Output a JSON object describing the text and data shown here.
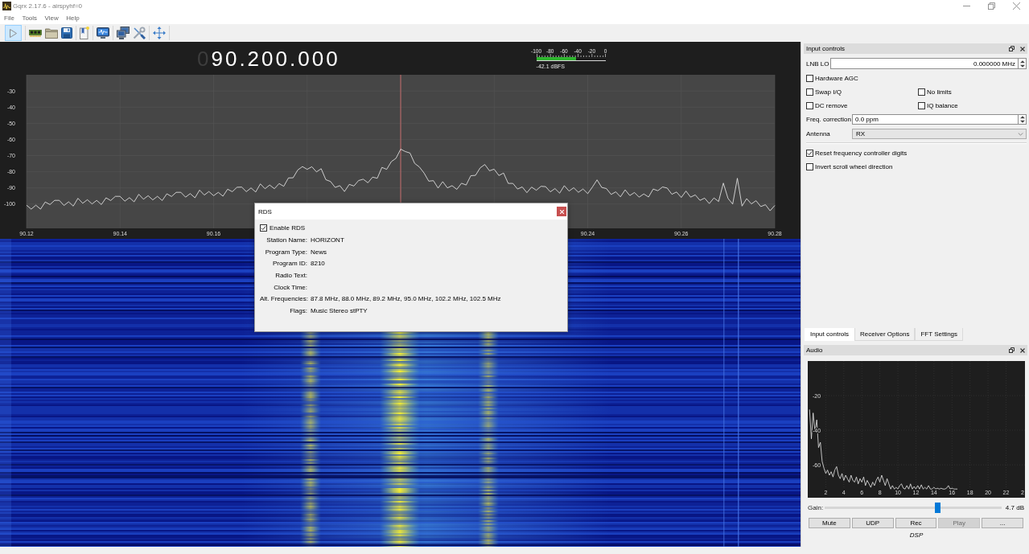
{
  "window": {
    "title": "Gqrx 2.17.6 - airspyhf=0"
  },
  "menu": [
    "File",
    "Tools",
    "View",
    "Help"
  ],
  "toolbar": {
    "start_button": {
      "on": true
    }
  },
  "receiver": {
    "frequency_leading": "0",
    "frequency": "90.200.000"
  },
  "signal_meter": {
    "scale": [
      "-100",
      "-80",
      "-60",
      "-40",
      "-20",
      "0"
    ],
    "level": 0.58,
    "reading": "-42.1 dBFS"
  },
  "spectrum": {
    "chart_data": {
      "type": "line",
      "xlim": [
        90.12,
        90.28
      ],
      "ylim": [
        -115,
        -20
      ],
      "xticks": [
        90.12,
        90.14,
        90.16,
        90.24,
        90.26,
        90.28
      ],
      "yticks": [
        -30,
        -40,
        -50,
        -60,
        -70,
        -80,
        -90,
        -100
      ],
      "grid": true,
      "color": "#f0f0f0",
      "ref_lines": [
        {
          "axis": "x",
          "value": 90.2,
          "color": "#c46a6a"
        }
      ],
      "x": [
        90.12,
        90.121,
        90.122,
        90.123,
        90.124,
        90.125,
        90.126,
        90.127,
        90.128,
        90.129,
        90.13,
        90.131,
        90.132,
        90.133,
        90.134,
        90.135,
        90.136,
        90.137,
        90.138,
        90.139,
        90.14,
        90.141,
        90.142,
        90.143,
        90.144,
        90.145,
        90.146,
        90.147,
        90.148,
        90.149,
        90.15,
        90.151,
        90.152,
        90.153,
        90.154,
        90.155,
        90.156,
        90.157,
        90.158,
        90.159,
        90.16,
        90.161,
        90.162,
        90.163,
        90.164,
        90.165,
        90.166,
        90.167,
        90.168,
        90.169,
        90.17,
        90.171,
        90.172,
        90.173,
        90.174,
        90.175,
        90.176,
        90.177,
        90.178,
        90.179,
        90.18,
        90.181,
        90.182,
        90.183,
        90.184,
        90.185,
        90.186,
        90.187,
        90.188,
        90.189,
        90.19,
        90.191,
        90.192,
        90.193,
        90.194,
        90.195,
        90.196,
        90.197,
        90.198,
        90.199,
        90.2,
        90.201,
        90.202,
        90.203,
        90.204,
        90.205,
        90.206,
        90.207,
        90.208,
        90.209,
        90.21,
        90.211,
        90.212,
        90.213,
        90.214,
        90.215,
        90.216,
        90.217,
        90.218,
        90.219,
        90.22,
        90.221,
        90.222,
        90.223,
        90.224,
        90.225,
        90.226,
        90.227,
        90.228,
        90.229,
        90.23,
        90.231,
        90.232,
        90.233,
        90.234,
        90.235,
        90.236,
        90.237,
        90.238,
        90.239,
        90.24,
        90.241,
        90.242,
        90.243,
        90.244,
        90.245,
        90.246,
        90.247,
        90.248,
        90.249,
        90.25,
        90.251,
        90.252,
        90.253,
        90.254,
        90.255,
        90.256,
        90.257,
        90.258,
        90.259,
        90.26,
        90.261,
        90.262,
        90.263,
        90.264,
        90.265,
        90.266,
        90.267,
        90.268,
        90.269,
        90.27,
        90.271,
        90.272,
        90.273,
        90.274,
        90.275,
        90.276,
        90.277,
        90.278,
        90.279,
        90.28
      ],
      "values": [
        -100.7,
        -103.1,
        -100.7,
        -103.1,
        -98.7,
        -100.3,
        -97.7,
        -97.7,
        -100.8,
        -98.6,
        -101.2,
        -96.4,
        -99.5,
        -97.3,
        -99.9,
        -97.7,
        -100.3,
        -96.1,
        -97.8,
        -95.2,
        -95.2,
        -98.2,
        -96.0,
        -98.6,
        -93.9,
        -97.0,
        -94.8,
        -97.4,
        -95.2,
        -97.8,
        -93.6,
        -95.3,
        -92.7,
        -92.7,
        -95.7,
        -93.5,
        -96.1,
        -91.3,
        -94.4,
        -92.2,
        -94.8,
        -92.7,
        -95.1,
        -90.8,
        -92.3,
        -89.6,
        -89.5,
        -92.3,
        -90.0,
        -92.5,
        -87.5,
        -90.5,
        -88.2,
        -90.5,
        -87.3,
        -89.0,
        -83.8,
        -83.7,
        -78.9,
        -76.8,
        -78.5,
        -76.9,
        -80.1,
        -78.1,
        -84.9,
        -86.0,
        -89.7,
        -88.6,
        -92.2,
        -87.8,
        -88.8,
        -85.4,
        -84.6,
        -86.8,
        -83.3,
        -84.0,
        -77.3,
        -78.5,
        -73.7,
        -71.7,
        -66.0,
        -67.5,
        -68.4,
        -74.8,
        -77.0,
        -80.8,
        -85.8,
        -85.5,
        -90.1,
        -86.1,
        -90.0,
        -88.6,
        -90.9,
        -87.1,
        -88.2,
        -82.4,
        -82.2,
        -77.6,
        -75.5,
        -79.4,
        -78.4,
        -82.3,
        -80.8,
        -87.2,
        -87.2,
        -90.7,
        -89.4,
        -92.9,
        -89.5,
        -91.4,
        -89.0,
        -89.2,
        -92.4,
        -90.4,
        -93.2,
        -88.6,
        -91.9,
        -89.9,
        -92.7,
        -90.7,
        -93.5,
        -89.5,
        -85.0,
        -89.7,
        -90.4,
        -94.0,
        -92.4,
        -95.5,
        -91.2,
        -94.7,
        -92.8,
        -95.7,
        -93.7,
        -95.6,
        -90.7,
        -91.7,
        -89.4,
        -90.1,
        -93.9,
        -92.5,
        -95.9,
        -91.9,
        -95.7,
        -94.3,
        -97.7,
        -96.3,
        -99.7,
        -96.2,
        -98.4,
        -87.0,
        -96.5,
        -100.0,
        -84.0,
        -101.2,
        -96.6,
        -99.9,
        -97.9,
        -101.5,
        -100.4,
        -104.1,
        -100.8
      ]
    }
  },
  "rds_dialog": {
    "title": "RDS",
    "enable": {
      "label": "Enable RDS",
      "checked": true
    },
    "fields": [
      {
        "label": "Station Name:",
        "value": "HORIZONT"
      },
      {
        "label": "Program Type:",
        "value": "News"
      },
      {
        "label": "Program ID:",
        "value": "8210"
      },
      {
        "label": "Radio Text:"
      },
      {
        "label": "Clock Time:"
      },
      {
        "label": "Alt. Frequencies:",
        "value": "87.8 MHz, 88.0 MHz, 89.2 MHz, 95.0 MHz, 102.2 MHz, 102.5 MHz"
      },
      {
        "label": "Flags:",
        "value": "Music Stereo stPTY"
      }
    ]
  },
  "input_controls": {
    "title": "Input controls",
    "lnb_lo": {
      "label": "LNB LO",
      "value": "0.000000 MHz"
    },
    "options": [
      [
        {
          "label": "Hardware AGC",
          "checked": false
        }
      ],
      [
        {
          "label": "Swap I/Q",
          "checked": false
        },
        {
          "label": "No limits",
          "checked": false
        }
      ],
      [
        {
          "label": "DC remove",
          "checked": false
        },
        {
          "label": "IQ balance",
          "checked": false
        }
      ]
    ],
    "freq_correction": {
      "label": "Freq. correction",
      "value": "0.0 ppm"
    },
    "antenna": {
      "label": "Antenna",
      "value": "RX"
    },
    "settings": [
      {
        "label": "Reset frequency controller digits",
        "checked": true
      },
      {
        "label": "Invert scroll wheel direction",
        "checked": false
      }
    ]
  },
  "dock_tabs": [
    {
      "label": "Input controls",
      "selected": true
    },
    {
      "label": "Receiver Options",
      "selected": false
    },
    {
      "label": "FFT Settings",
      "selected": false
    }
  ],
  "audio": {
    "title": "Audio",
    "chart_data": {
      "type": "line",
      "xlim": [
        0,
        24.1
      ],
      "ylim": [
        -79,
        0
      ],
      "xticks": [
        2,
        4,
        6,
        8,
        10,
        12,
        14,
        16,
        18,
        20,
        22
      ],
      "yticks": [
        -20,
        -40,
        -60
      ],
      "grid": true,
      "color": "#eaeaea",
      "x": [
        0.2,
        0.4,
        0.6,
        0.8,
        1,
        1.2,
        1.4,
        1.6,
        1.8,
        2,
        2.2,
        2.4,
        2.6,
        2.8,
        3,
        3.2,
        3.4,
        3.6,
        3.8,
        4,
        4.2,
        4.4,
        4.6,
        4.8,
        5,
        5.2,
        5.4,
        5.6,
        5.8,
        6,
        6.2,
        6.4,
        6.6,
        6.8,
        7,
        7.2,
        7.4,
        7.6,
        7.8,
        8,
        8.2,
        8.4,
        8.6,
        8.8,
        9,
        9.2,
        9.4,
        9.6,
        9.8,
        10,
        10.2,
        10.4,
        10.6,
        10.8,
        11,
        11.2,
        11.4,
        11.6,
        11.8,
        12,
        12.2,
        12.4,
        12.6,
        12.8,
        13,
        13.2,
        13.4,
        13.6,
        13.8,
        14,
        14.2,
        14.4,
        14.6,
        14.8,
        15,
        15.2,
        15.4,
        15.6,
        15.8,
        16,
        16.2,
        16.4,
        16.6
      ],
      "values": [
        -28,
        -45,
        -30,
        -41,
        -34,
        -50,
        -47,
        -58,
        -62,
        -65,
        -63,
        -66,
        -64,
        -67,
        -63,
        -61,
        -66,
        -68,
        -65,
        -69,
        -66,
        -68,
        -70,
        -66,
        -69,
        -70,
        -67,
        -71,
        -68,
        -70,
        -67,
        -72,
        -69,
        -71,
        -73,
        -70,
        -72,
        -69,
        -67,
        -70,
        -66,
        -69,
        -72,
        -68,
        -71,
        -74,
        -72,
        -74,
        -73,
        -74,
        -72,
        -71,
        -73.5,
        -74,
        -72,
        -74,
        -71,
        -74,
        -72.5,
        -74,
        -72,
        -74,
        -71.5,
        -74,
        -73,
        -74,
        -72,
        -74,
        -74,
        -73,
        -74,
        -73.5,
        -74,
        -73.5,
        -74,
        -74,
        -73.5,
        -72,
        -74,
        -73.5,
        -74,
        -74,
        -74
      ]
    },
    "x_edge_label": "2",
    "gain": {
      "label": "Gain:",
      "level": 0.64,
      "reading": "4.7 dB"
    },
    "buttons": [
      {
        "label": "Mute",
        "disabled": false
      },
      {
        "label": "UDP",
        "disabled": false
      },
      {
        "label": "Rec",
        "disabled": false
      },
      {
        "label": "Play",
        "disabled": true
      },
      {
        "label": "...",
        "disabled": false
      }
    ]
  },
  "dsp_label": "DSP"
}
